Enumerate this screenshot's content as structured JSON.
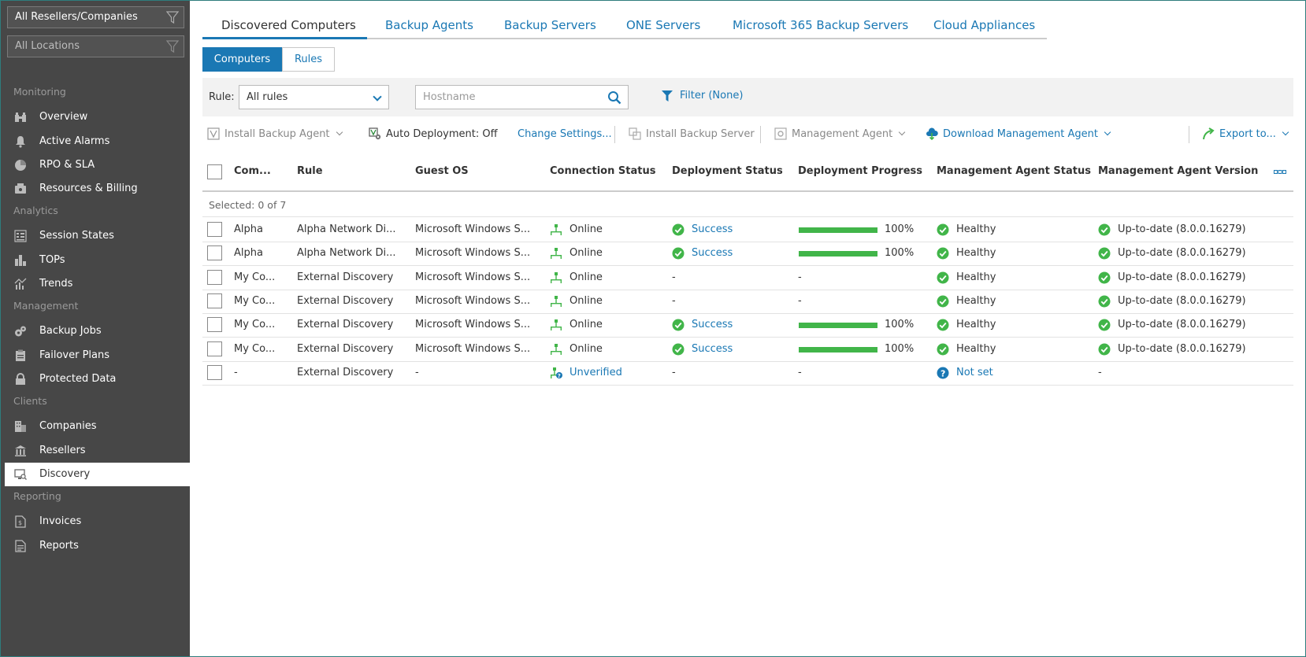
{
  "sidebar": {
    "scope_filter": "All Resellers/Companies",
    "location_filter": "All Locations",
    "sections": {
      "monitoring": "Monitoring",
      "analytics": "Analytics",
      "management": "Management",
      "clients": "Clients",
      "reporting": "Reporting"
    },
    "items": {
      "overview": "Overview",
      "active_alarms": "Active Alarms",
      "rpo_sla": "RPO & SLA",
      "resources_billing": "Resources & Billing",
      "session_states": "Session States",
      "tops": "TOPs",
      "trends": "Trends",
      "backup_jobs": "Backup Jobs",
      "failover_plans": "Failover Plans",
      "protected_data": "Protected Data",
      "companies": "Companies",
      "resellers": "Resellers",
      "discovery": "Discovery",
      "invoices": "Invoices",
      "reports": "Reports"
    },
    "active_item": "discovery"
  },
  "tabs": [
    "Discovered Computers",
    "Backup Agents",
    "Backup Servers",
    "ONE Servers",
    "Microsoft 365 Backup Servers",
    "Cloud Appliances"
  ],
  "subtabs": [
    "Computers",
    "Rules"
  ],
  "filterbar": {
    "rule_label": "Rule:",
    "rule_value": "All rules",
    "hostname_placeholder": "Hostname",
    "filter_label": "Filter (None)"
  },
  "toolbar": {
    "install_backup_agent": "Install Backup Agent",
    "auto_deployment": "Auto Deployment: Off",
    "change_settings": "Change Settings...",
    "install_backup_server": "Install Backup Server",
    "management_agent": "Management Agent",
    "download_management_agent": "Download Management Agent",
    "export_to": "Export to..."
  },
  "table": {
    "columns": [
      "Com...",
      "Rule",
      "Guest OS",
      "Connection Status",
      "Deployment Status",
      "Deployment Progress",
      "Management Agent Status",
      "Management Agent Version"
    ],
    "selected_text": "Selected: 0 of 7",
    "rows": [
      {
        "computer": "Alpha",
        "rule": "Alpha Network Di...",
        "os": "Microsoft Windows S...",
        "conn": "Online",
        "deploy": "Success",
        "progress": 100,
        "progress_text": "100%",
        "agent": "Healthy",
        "version": "Up-to-date (8.0.0.16279)"
      },
      {
        "computer": "Alpha",
        "rule": "Alpha Network Di...",
        "os": "Microsoft Windows S...",
        "conn": "Online",
        "deploy": "Success",
        "progress": 100,
        "progress_text": "100%",
        "agent": "Healthy",
        "version": "Up-to-date (8.0.0.16279)"
      },
      {
        "computer": "My Co...",
        "rule": "External Discovery",
        "os": "Microsoft Windows S...",
        "conn": "Online",
        "deploy": "-",
        "progress": null,
        "progress_text": "-",
        "agent": "Healthy",
        "version": "Up-to-date (8.0.0.16279)"
      },
      {
        "computer": "My Co...",
        "rule": "External Discovery",
        "os": "Microsoft Windows S...",
        "conn": "Online",
        "deploy": "-",
        "progress": null,
        "progress_text": "-",
        "agent": "Healthy",
        "version": "Up-to-date (8.0.0.16279)"
      },
      {
        "computer": "My Co...",
        "rule": "External Discovery",
        "os": "Microsoft Windows S...",
        "conn": "Online",
        "deploy": "Success",
        "progress": 100,
        "progress_text": "100%",
        "agent": "Healthy",
        "version": "Up-to-date (8.0.0.16279)"
      },
      {
        "computer": "My Co...",
        "rule": "External Discovery",
        "os": "Microsoft Windows S...",
        "conn": "Online",
        "deploy": "Success",
        "progress": 100,
        "progress_text": "100%",
        "agent": "Healthy",
        "version": "Up-to-date (8.0.0.16279)"
      },
      {
        "computer": "-",
        "rule": "External Discovery",
        "os": "-",
        "conn": "Unverified",
        "deploy": "-",
        "progress": null,
        "progress_text": "-",
        "agent": "Not set",
        "version": "-"
      }
    ]
  },
  "colors": {
    "sidebar_bg": "#474747",
    "accent": "#1a78b4",
    "success": "#41b549",
    "unknown": "#1a78b4"
  }
}
